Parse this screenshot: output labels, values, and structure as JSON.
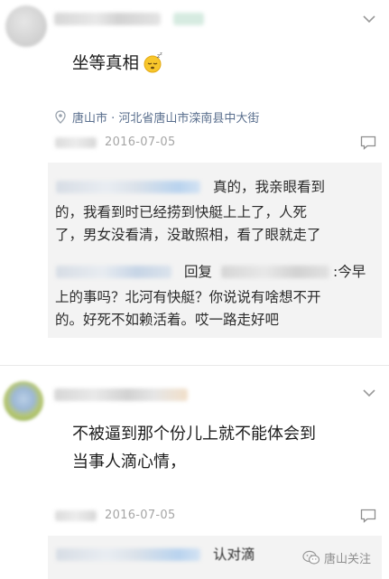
{
  "post1": {
    "text": "坐等真相",
    "emoji_icon": "sleepy-face-icon",
    "location_text": "唐山市 · 河北省唐山市滦南县中大街",
    "date": "2016-07-05",
    "replies": [
      {
        "line1": "真的，我亲眼看到",
        "line2": "的，我看到时已经捞到快艇上上了，人死",
        "line3": "了，男女没看清，没敢照相，看了眼就走了"
      },
      {
        "prefix": "回复",
        "line1_tail": ":今早",
        "line2": "上的事吗？北河有快艇？你说说有啥想不开",
        "line3": "的。好死不如赖活着。哎一路走好吧"
      }
    ]
  },
  "post2": {
    "line1": "不被逼到那个份儿上就不能体会到",
    "line2": "当事人滴心情，",
    "date": "2016-07-05",
    "reply_partial": "认对滴"
  },
  "watermark": {
    "text": "唐山关注",
    "icon": "wechat-icon"
  },
  "colors": {
    "location": "#5a6f8e",
    "meta": "#a6a6a6",
    "reply_bg": "#f3f3f3"
  }
}
